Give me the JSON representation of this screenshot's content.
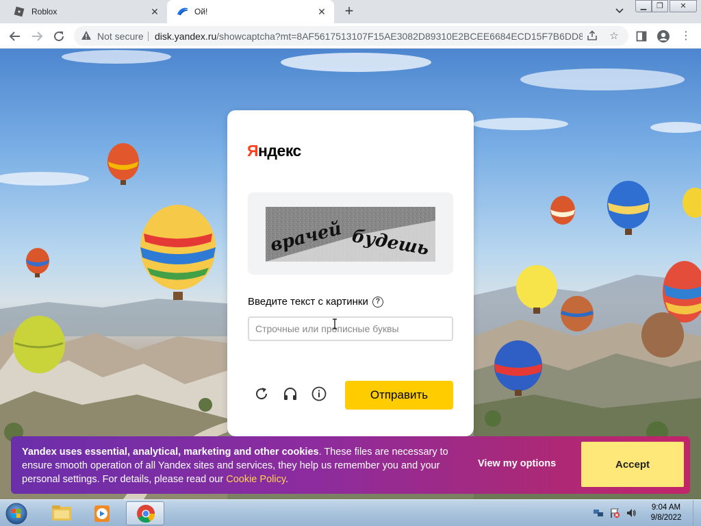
{
  "browser": {
    "tabs": [
      {
        "title": "Roblox",
        "active": false
      },
      {
        "title": "Ой!",
        "active": true
      }
    ],
    "security_label": "Not secure",
    "url_host": "disk.yandex.ru",
    "url_rest": "/showcaptcha?mt=8AF5617513107F15AE3082D89310E2BCEE6684ECD15F7B6DD84C..."
  },
  "captcha": {
    "logo": "Яндекс",
    "image_text": "врачей будешь",
    "prompt": "Введите текст с картинки",
    "input_placeholder": "Строчные или прописные буквы",
    "input_value": "",
    "submit_label": "Отправить"
  },
  "cookie_banner": {
    "lead": "Yandex uses essential, analytical, marketing and other cookies",
    "body": ". These files are necessary to ensure smooth operation of all Yandex sites and services, they help us remember you and your personal settings. For details, please read our ",
    "link": "Cookie Policy",
    "tail": ".",
    "options_label": "View my options",
    "accept_label": "Accept"
  },
  "taskbar": {
    "time": "9:04 AM",
    "date": "9/8/2022",
    "apps": [
      "explorer",
      "media-player",
      "chrome"
    ]
  },
  "colors": {
    "yandex_red": "#fc3f1d",
    "submit_yellow": "#ffcc00",
    "accept_yellow": "#fee87a"
  }
}
